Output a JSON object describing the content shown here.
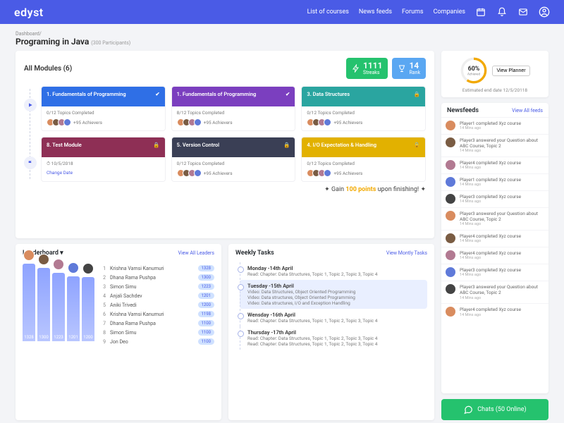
{
  "brand": "edyst",
  "nav": {
    "courses": "List of courses",
    "news": "News feeds",
    "forums": "Forums",
    "companies": "Companies"
  },
  "breadcrumb": "Dashboard/",
  "page_title": "Programing in Java",
  "page_sub": "(300 Participants)",
  "modules_heading": "All Modules (6)",
  "streaks": {
    "value": "1111",
    "label": "Streaks"
  },
  "rank": {
    "value": "14",
    "label": "Rank"
  },
  "cards": [
    {
      "title": "1. Fundamentals of Programming",
      "bg": "#2f6fe6",
      "progress": "0/12 Topics Completed",
      "ach": "+95 Achievers",
      "locked": false
    },
    {
      "title": "1. Fundamentals of Programming",
      "bg": "#7b3fbf",
      "progress": "8/12 Topics Completed",
      "ach": "+95 Achievers",
      "locked": false
    },
    {
      "title": "3. Data Structures",
      "bg": "#2aa5a0",
      "progress": "0/12 Topics Completed",
      "ach": "+95 Achievers",
      "locked": true
    },
    {
      "title": "8. Test Module",
      "bg": "#8e2f55",
      "progress": "⏱ 10/5/2018",
      "ach": "Change Date",
      "locked": true
    },
    {
      "title": "5. Version Control",
      "bg": "#3a3f55",
      "progress": "0/12 Topics Completed",
      "ach": "+95 Achievers",
      "locked": true
    },
    {
      "title": "4. I/O Expectation & Handling",
      "bg": "#e2b100",
      "progress": "0/12 Topics Completed",
      "ach": "+95 Achievers",
      "locked": true
    }
  ],
  "gain": {
    "pre": "Gain ",
    "pts": "100 points",
    "post": " upon finishing!"
  },
  "progress": {
    "pct": "60%",
    "label": "Achieved",
    "btn": "View Planner",
    "end": "Estimated end date 12/5/20118"
  },
  "newsfeeds": {
    "title": "Newsfeeds",
    "link": "View All feeds"
  },
  "feeds": [
    {
      "t": "Player1 completed Xyz course",
      "w": "14 Mins ago"
    },
    {
      "t": "Player3 answered your Question about ABC Course, Topic 2",
      "w": "14 Mins ago"
    },
    {
      "t": "Player4 completed Xyz course",
      "w": "14 Mins ago"
    },
    {
      "t": "Player1 completed Xyz course",
      "w": "14 Mins ago"
    },
    {
      "t": "Player3 completed Xyz course",
      "w": "14 Mins ago"
    },
    {
      "t": "Player3 answered your Question about ABC Course, Topic 2",
      "w": "14 Mins ago"
    },
    {
      "t": "Player4 completed Xyz course",
      "w": "14 Mins ago"
    },
    {
      "t": "Player4 completed Xyz course",
      "w": "14 Mins ago"
    },
    {
      "t": "Player3 completed Xyz course",
      "w": "14 Mins ago"
    },
    {
      "t": "Player3 answered your Question about ABC Course, Topic 2",
      "w": "14 Mins ago"
    },
    {
      "t": "Player4 completed Xyz course",
      "w": "14 Mins ago"
    }
  ],
  "leaderboard": {
    "title": "Leaderboard ▾",
    "link": "View All Leaders"
  },
  "bars": [
    1328,
    1300,
    1223,
    1201,
    1200
  ],
  "ranks": [
    {
      "n": "1",
      "name": "Krishna Vamsi Kanumuri",
      "pts": "1328"
    },
    {
      "n": "2",
      "name": "Dhana Rama Pushpa",
      "pts": "1300"
    },
    {
      "n": "3",
      "name": "Simon Simu",
      "pts": "1223"
    },
    {
      "n": "4",
      "name": "Anjali Sachdev",
      "pts": "1201"
    },
    {
      "n": "5",
      "name": "Aniki Trivedi",
      "pts": "1200"
    },
    {
      "n": "6",
      "name": "Krishna Vamsi Kanumuri",
      "pts": "1198"
    },
    {
      "n": "7",
      "name": "Dhana Rama Pushpa",
      "pts": "1100"
    },
    {
      "n": "8",
      "name": "Simon Simu",
      "pts": "1100"
    },
    {
      "n": "9",
      "name": "Jon Deo",
      "pts": "1100"
    }
  ],
  "weekly": {
    "title": "Weekly Tasks",
    "link": "View Montly Tasks"
  },
  "tasks": [
    {
      "h": "Monday -14th April",
      "d": "Read: Chapter: Data Structures, Topic 1, Topic 2, Topic 3, Topic 4"
    },
    {
      "h": "Tuesday -15th April",
      "d": "Video: Data Structures, Object Oriented Programming\nVideo: Data structures, Object Oriented Programming\nVideo: Data structures, I/O and Exception Handling"
    },
    {
      "h": "Wensday\n                    -16th April",
      "d": "Read: Chapter: Data Structures, Topic 1, Topic 2, Topic 3, Topic 4"
    },
    {
      "h": "Thursday -17th April",
      "d": "Read: Chapter: Data Structures, Topic 1, Topic 2, Topic 3, Topic 4\nRead: Chapter: Data Structures, Topic 1, Topic 2, Topic 3, Topic 4"
    }
  ],
  "chat": "Chats (50 Online)",
  "colors": {
    "accent": "#4a5be6",
    "green": "#25c26e",
    "blue": "#5aa7f2",
    "gold": "#f2a900"
  }
}
